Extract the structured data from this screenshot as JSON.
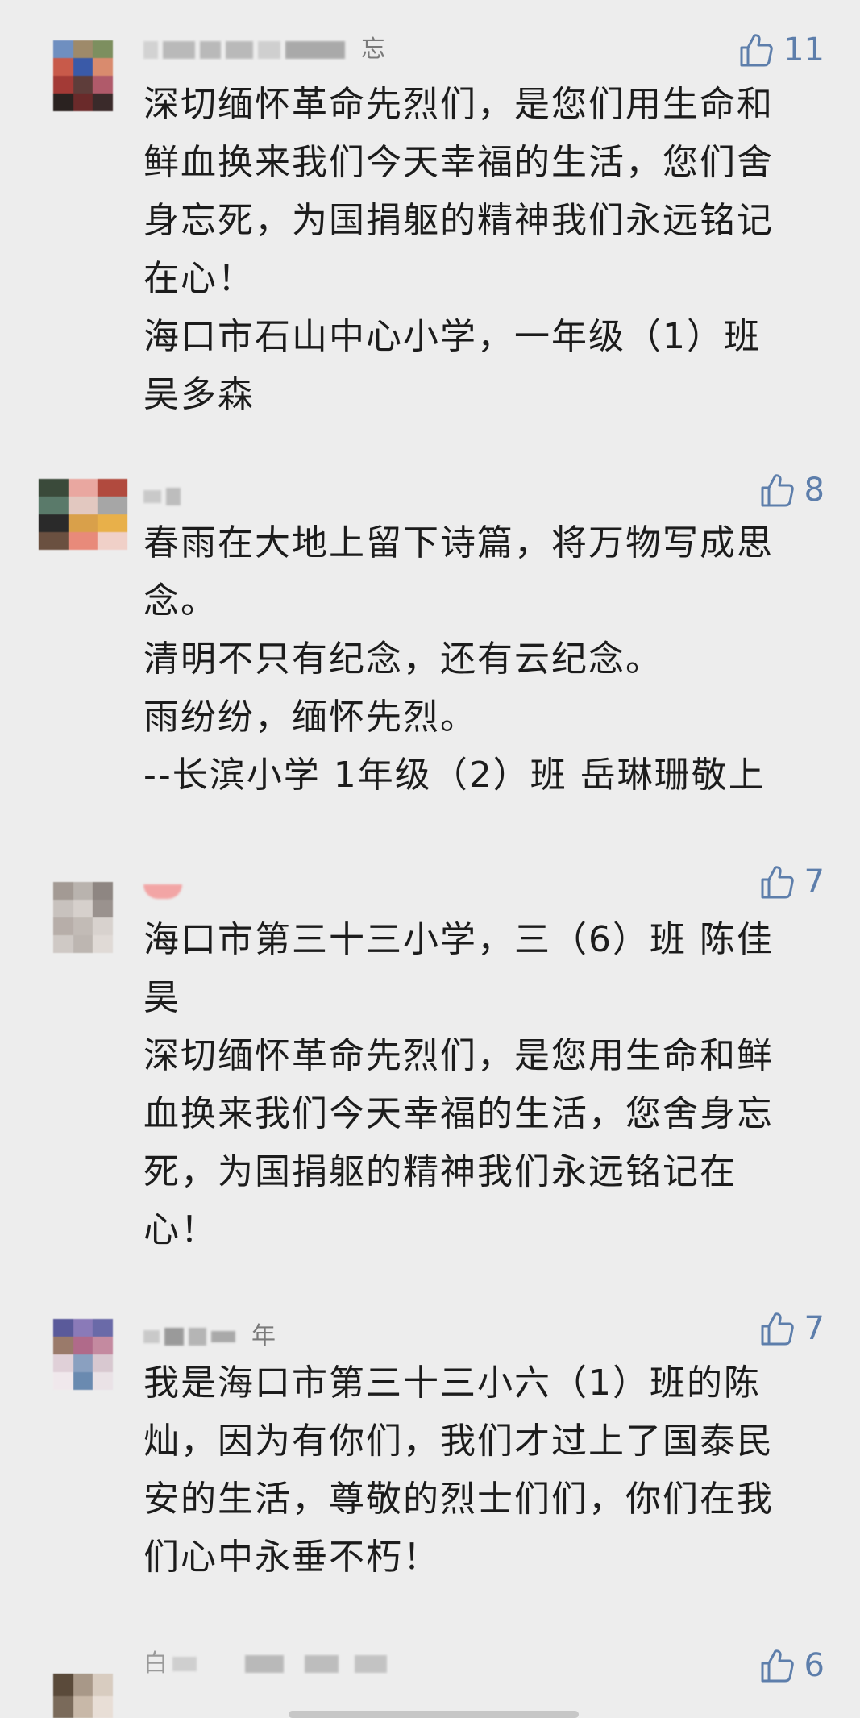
{
  "accent_color": "#5d7eab",
  "comments": [
    {
      "nickname_partial": "忘",
      "likes": "11",
      "lines": [
        "深切缅怀革命先烈们，是您们用生命和",
        "鲜血换来我们今天幸福的生活，您们舍",
        "身忘死，为国捐躯的精神我们永远铭记",
        "在心！",
        "海口市石山中心小学，一年级（1）班",
        "吴多森"
      ]
    },
    {
      "nickname_partial": "",
      "likes": "8",
      "lines": [
        "春雨在大地上留下诗篇，将万物写成思",
        "念。",
        "清明不只有纪念，还有云纪念。",
        "雨纷纷，缅怀先烈。",
        "--长滨小学 1年级（2）班 岳琳珊敬上"
      ]
    },
    {
      "nickname_partial": "",
      "likes": "7",
      "lines": [
        "海口市第三十三小学，三（6）班 陈佳",
        "昊",
        "深切缅怀革命先烈们，是您用生命和鲜",
        "血换来我们今天幸福的生活，您舍身忘",
        "死，为国捐躯的精神我们永远铭记在",
        "心！"
      ]
    },
    {
      "nickname_partial": "年",
      "likes": "7",
      "lines": [
        "我是海口市第三十三小六（1）班的陈",
        "灿，因为有你们，我们才过上了国泰民",
        "安的生活，尊敬的烈士们们，你们在我",
        "们心中永垂不朽！"
      ]
    },
    {
      "nickname_partial": "白",
      "likes": "6",
      "lines": []
    }
  ]
}
